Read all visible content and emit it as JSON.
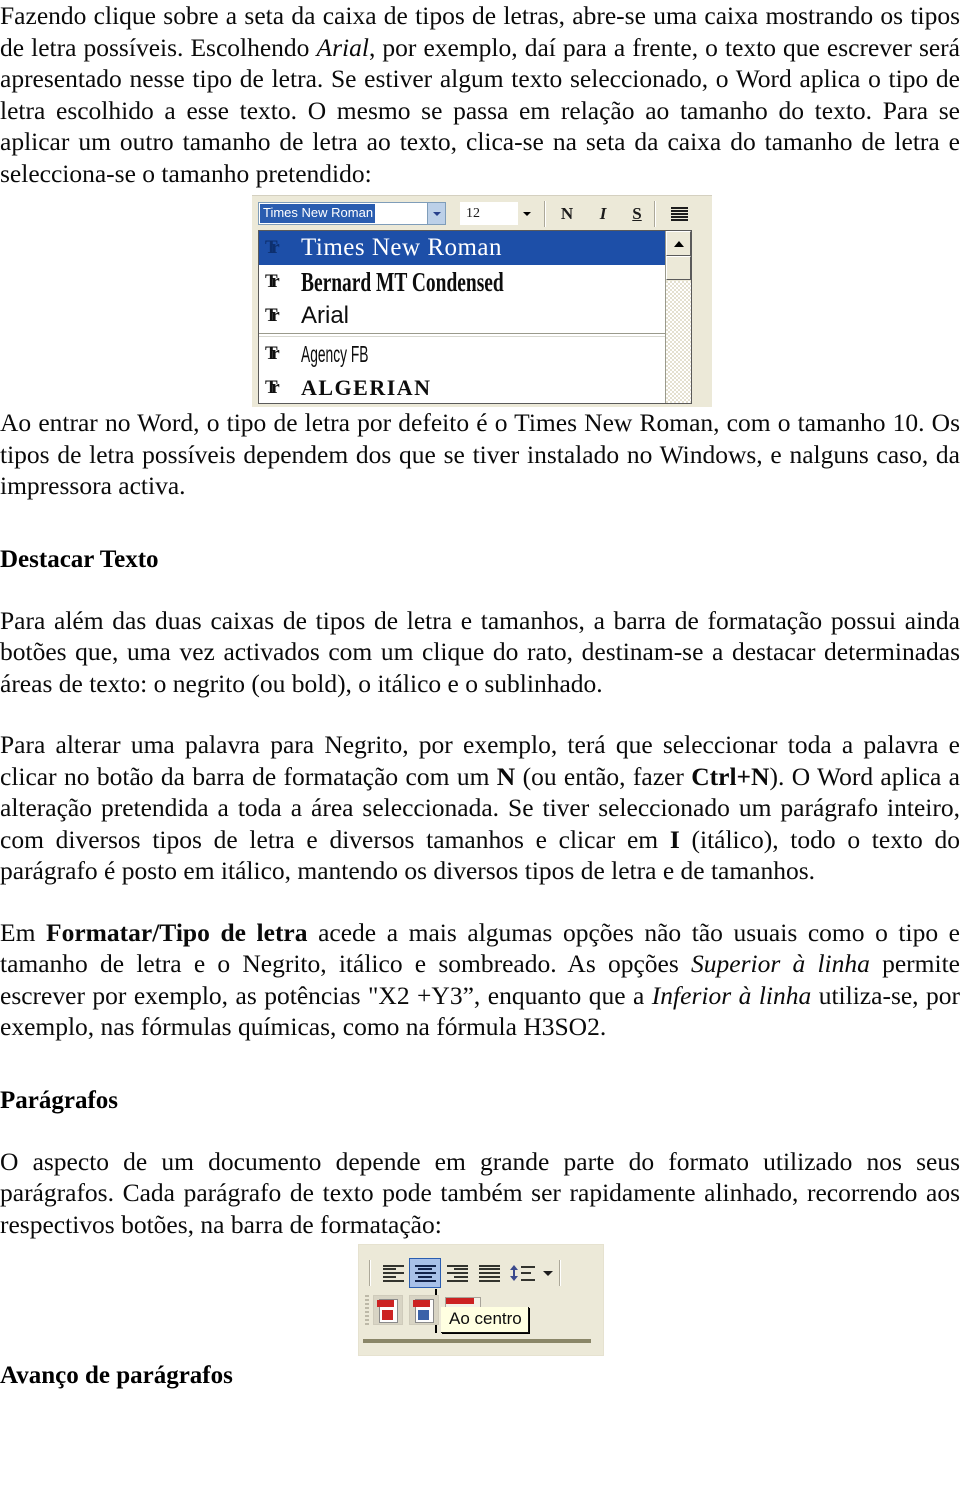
{
  "document": {
    "language": "pt-PT",
    "paragraphs": {
      "intro_1": "Fazendo clique sobre a seta da caixa de tipos de letras, abre-se uma caixa mostrando os tipos de letra possíveis. Escolhendo ",
      "intro_1_italic": "Arial",
      "intro_1_cont": ", por exemplo, daí para a frente, o texto que escrever será apresentado nesse tipo de letra. Se estiver algum texto seleccionado, o Word aplica o tipo de letra escolhido a esse texto. O mesmo se passa em relação ao tamanho do texto. Para se aplicar um outro tamanho de letra ao texto, clica-se na seta da caixa do tamanho de letra e selecciona-se o tamanho pretendido:",
      "after_fig_1": "Ao entrar no Word, o tipo de letra por defeito é o Times New Roman, com o tamanho 10. Os tipos de letra possíveis dependem dos que se tiver instalado no Windows, e nalguns caso, da impressora activa.",
      "destacar_1": "Para além das duas caixas de tipos de letra e tamanhos, a barra de formatação possui ainda botões que, uma vez activados com um clique do rato, destinam-se a destacar determinadas áreas de texto: o negrito (ou bold), o itálico e o sublinhado.",
      "destacar_2_a": "Para alterar uma palavra para Negrito, por exemplo, terá que seleccionar toda a palavra e clicar no botão da barra de formatação com um ",
      "destacar_2_b": "N",
      "destacar_2_c": " (ou então, fazer ",
      "destacar_2_d": "Ctrl+N",
      "destacar_2_e": "). O Word aplica a alteração pretendida a toda a área seleccionada. Se tiver seleccionado um parágrafo inteiro, com diversos tipos de letra e diversos tamanhos e clicar em ",
      "destacar_2_f": "I",
      "destacar_2_g": " (itálico), todo o texto do parágrafo é posto em itálico, mantendo os diversos tipos de letra e de tamanhos.",
      "formatar_a": "Em ",
      "formatar_b": "Formatar/Tipo de letra",
      "formatar_c": " acede a mais algumas opções não tão usuais como o tipo e tamanho de letra e o Negrito, itálico e sombreado. As opções ",
      "formatar_d": "Superior à linha",
      "formatar_e": " permite escrever por exemplo, as potências \"X2 +Y3”, enquanto que a ",
      "formatar_f": "Inferior à linha",
      "formatar_g": " utiliza-se, por exemplo, nas fórmulas químicas, como na fórmula H3SO2.",
      "paragrafos_1": "O aspecto de um documento depende em grande parte do formato utilizado nos seus parágrafos. Cada parágrafo de texto pode também ser rapidamente alinhado, recorrendo aos respectivos botões, na barra de formatação:"
    },
    "headings": {
      "destacar_texto": "Destacar Texto",
      "paragrafos": "Parágrafos",
      "avanco_de_paragrafos": "Avanço de parágrafos"
    }
  },
  "figure_font_dropdown": {
    "toolbar": {
      "font_name_value": "Times New Roman",
      "font_name_arrow_icon": "chevron-down-icon",
      "font_size_value": "12",
      "font_size_arrow_icon": "chevron-down-icon",
      "bold_label": "N",
      "italic_label": "I",
      "underline_label": "S",
      "align_icon": "align-justify-icon"
    },
    "list": {
      "scroll_up_icon": "triangle-up-icon",
      "items": [
        {
          "label": "Times New Roman",
          "style": "times",
          "icon": "truetype-icon",
          "selected": true
        },
        {
          "label": "Bernard MT Condensed",
          "style": "bernard",
          "icon": "truetype-icon",
          "selected": false
        },
        {
          "label": "Arial",
          "style": "arial",
          "icon": "truetype-icon",
          "selected": false
        },
        {
          "label": "Agency FB",
          "style": "agency",
          "icon": "truetype-icon",
          "selected": false
        },
        {
          "label": "ALGERIAN",
          "style": "algerian",
          "icon": "truetype-icon",
          "selected": false
        }
      ],
      "divider_after_index": 2
    },
    "colors": {
      "selection_blue": "#1d4fa8",
      "toolbar_face": "#ece9d8",
      "combo_arrow_blue": "#bcd0e8"
    }
  },
  "figure_align_toolbar": {
    "buttons": [
      {
        "name": "align-left-button",
        "icon": "align-left-icon",
        "active": false
      },
      {
        "name": "align-center-button",
        "icon": "align-center-icon",
        "active": true
      },
      {
        "name": "align-right-button",
        "icon": "align-right-icon",
        "active": false
      },
      {
        "name": "align-justify-button",
        "icon": "align-justify-icon",
        "active": false
      },
      {
        "name": "line-spacing-button",
        "icon": "line-spacing-icon",
        "active": false
      }
    ],
    "dropdown_icon": "chevron-down-icon",
    "tooltip_text": "Ao centro",
    "pdf_buttons": [
      {
        "name": "create-pdf-button",
        "icon": "pdf-document-icon"
      },
      {
        "name": "create-and-email-pdf-button",
        "icon": "pdf-email-icon"
      },
      {
        "name": "pdf-wide-button",
        "icon": "pdf-wide-icon"
      }
    ],
    "colors": {
      "active_button_fill": "#a8c0e8",
      "active_button_border": "#2a5db0",
      "tooltip_background": "#ffffe1",
      "toolbar_face": "#ece9d8"
    }
  }
}
